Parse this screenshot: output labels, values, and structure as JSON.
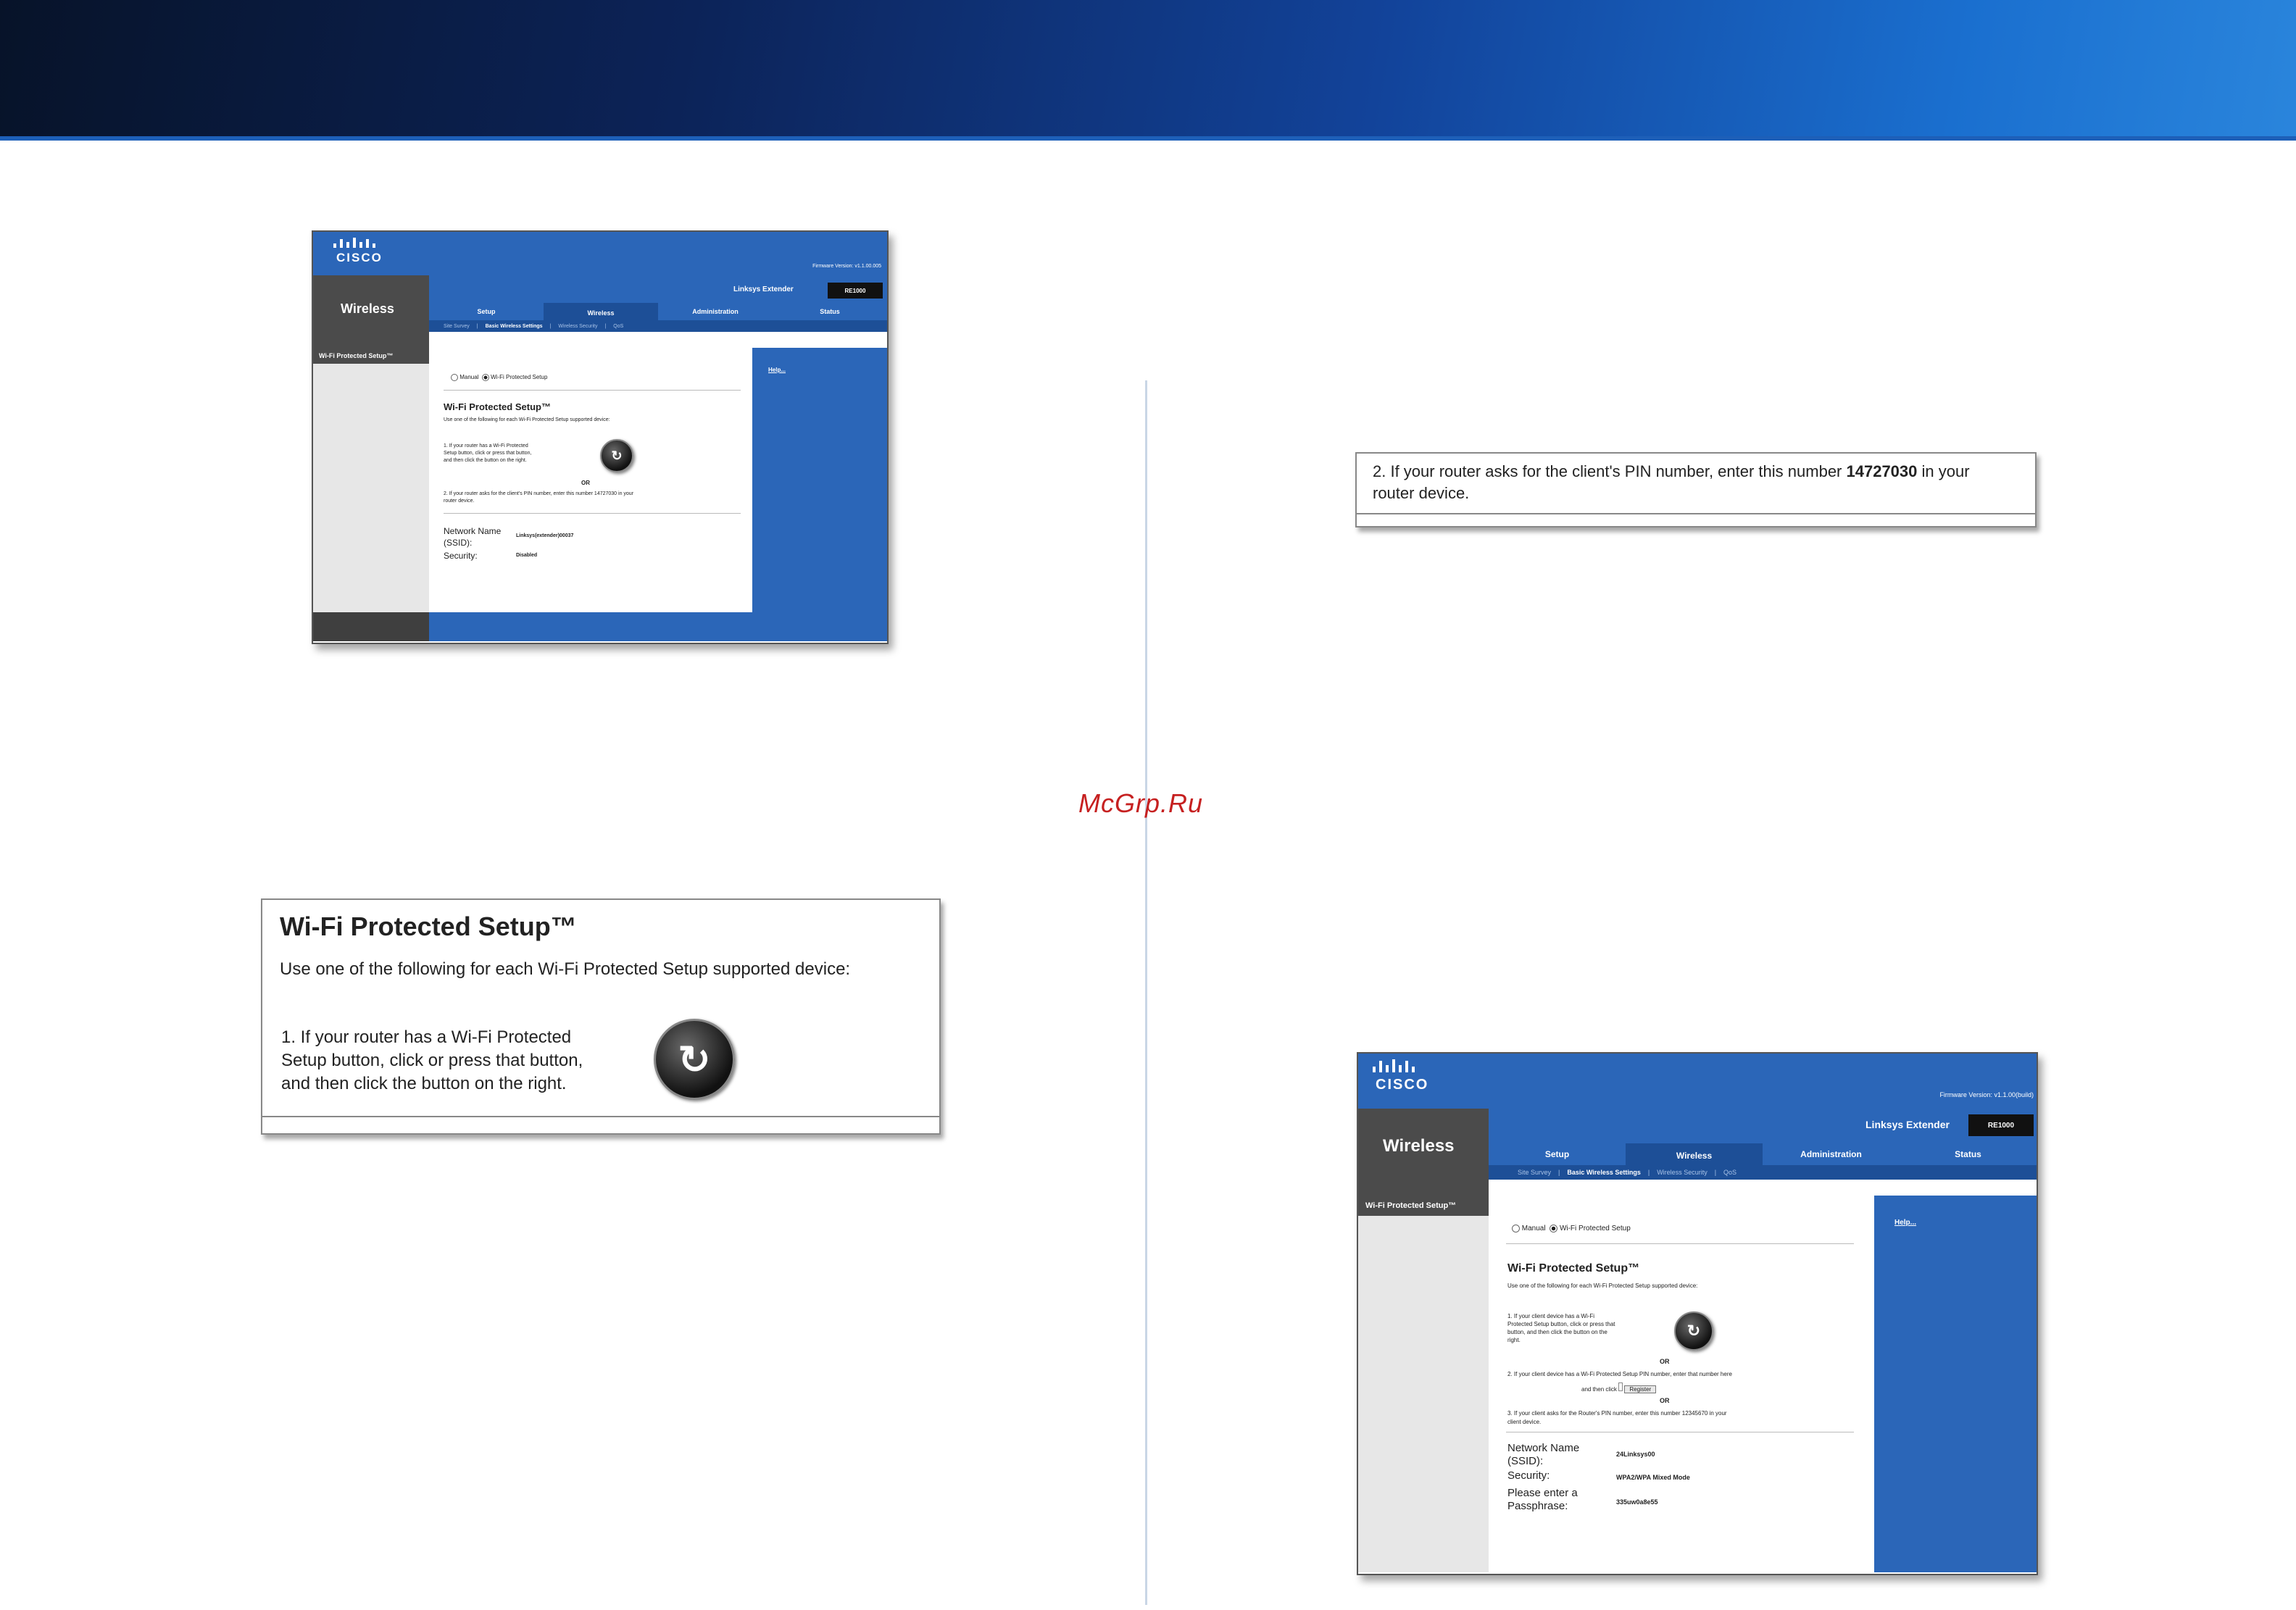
{
  "watermark": "McGrp.Ru",
  "shot1": {
    "logo": "CISCO",
    "firmware": "Firmware Version: v1.1.00.005",
    "section": "Wireless",
    "product": "Linksys Extender",
    "model": "RE1000",
    "tabs": [
      "Setup",
      "Wireless",
      "Administration",
      "Status"
    ],
    "subtabs": [
      "Site Survey",
      "Basic Wireless Settings",
      "Wireless Security",
      "QoS"
    ],
    "sidebar_label": "Wi-Fi Protected Setup™",
    "help_link": "Help...",
    "radio_manual": "Manual",
    "radio_wps": "Wi-Fi Protected Setup",
    "heading": "Wi-Fi Protected Setup™",
    "intro": "Use one of the following for each Wi-Fi Protected Setup supported device:",
    "step1": [
      "1. If your router has a Wi-Fi Protected",
      "Setup button, click or press that button,",
      "and then click the button on the right."
    ],
    "or": "OR",
    "step2": [
      "2. If your router asks for the client's PIN number, enter this number 14727030 in your",
      "router device."
    ],
    "ssid_label": [
      "Network Name",
      "(SSID):"
    ],
    "ssid_value": "Linksys(extender)00037",
    "security_label": "Security:",
    "security_value": "Disabled"
  },
  "callout_wps": {
    "heading": "Wi-Fi Protected Setup™",
    "intro": "Use one of the following for each Wi-Fi Protected Setup supported device:",
    "step1": [
      "1. If your router has a Wi-Fi Protected",
      "Setup button, click or press that button,",
      "and then click the button on the right."
    ]
  },
  "callout_pin": {
    "text_before": "2. If your router asks for the client's PIN number, enter this number ",
    "pin": "14727030",
    "text_after": " in your",
    "line2": "router device."
  },
  "shot2": {
    "logo": "CISCO",
    "firmware": "Firmware Version: v1.1.00(build)",
    "section": "Wireless",
    "product": "Linksys Extender",
    "model": "RE1000",
    "tabs": [
      "Setup",
      "Wireless",
      "Administration",
      "Status"
    ],
    "subtabs": [
      "Site Survey",
      "Basic Wireless Settings",
      "Wireless Security",
      "QoS"
    ],
    "sidebar_label": "Wi-Fi Protected Setup™",
    "help_link": "Help...",
    "radio_manual": "Manual",
    "radio_wps": "Wi-Fi Protected Setup",
    "heading": "Wi-Fi Protected Setup™",
    "intro": "Use one of the following for each Wi-Fi Protected Setup supported device:",
    "step1": [
      "1. If your client device has a Wi-Fi",
      "Protected Setup button, click or press that",
      "button, and then click the button on the",
      "right."
    ],
    "or1": "OR",
    "step2_a": "2. If your client device has a Wi-Fi Protected Setup PIN number, enter that number here",
    "step2_b": "and then click",
    "register": "Register",
    "or2": "OR",
    "step3_a": "3. If your client asks for the Router's PIN number, enter this number 12345670 in your",
    "step3_b": "client device.",
    "ssid_label": [
      "Network Name",
      "(SSID):"
    ],
    "ssid_value": "24Linksys00",
    "security_label": "Security:",
    "security_value": "WPA2/WPA Mixed Mode",
    "pass_label": [
      "Please enter a",
      "Passphrase:"
    ],
    "pass_value": "335uw0a8e55"
  }
}
